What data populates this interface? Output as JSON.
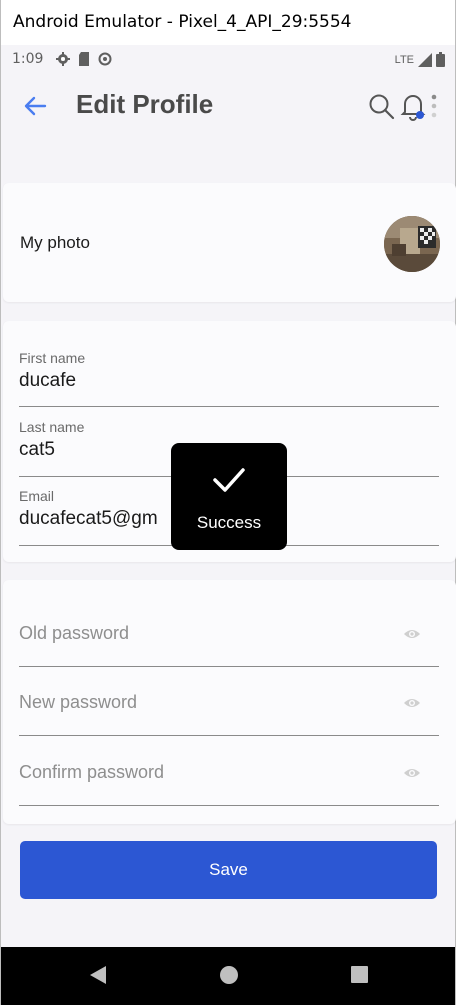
{
  "window": {
    "title": "Android Emulator - Pixel_4_API_29:5554"
  },
  "status_bar": {
    "time": "1:09",
    "network": "LTE",
    "left_icons": [
      "gear-icon",
      "sd-card-icon",
      "no-disturb-icon"
    ],
    "right_icons": [
      "signal-icon",
      "battery-icon"
    ]
  },
  "appbar": {
    "title": "Edit Profile",
    "icons": [
      "back-arrow-icon",
      "search-icon",
      "bell-icon",
      "more-vert-icon"
    ],
    "accent": "#4a7df0"
  },
  "photo_card": {
    "label": "My photo"
  },
  "profile": {
    "first_name": {
      "label": "First name",
      "value": "ducafe"
    },
    "last_name": {
      "label": "Last name",
      "value": "cat5"
    },
    "email": {
      "label": "Email",
      "value": "ducafecat5@gm"
    }
  },
  "passwords": {
    "old": {
      "placeholder": "Old password"
    },
    "new": {
      "placeholder": "New password"
    },
    "confirm": {
      "placeholder": "Confirm password"
    }
  },
  "save_button": {
    "label": "Save",
    "color": "#2c57d3"
  },
  "toast": {
    "text": "Success"
  },
  "nav_bar": {
    "icons": [
      "nav-back-icon",
      "nav-home-icon",
      "nav-recents-icon"
    ]
  }
}
